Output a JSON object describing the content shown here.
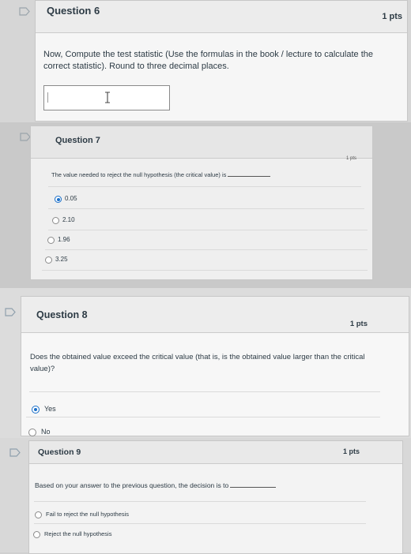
{
  "q6": {
    "title": "Question 6",
    "points": "1 pts",
    "text": "Now, Compute the test statistic (Use the formulas in the book / lecture to calculate the correct statistic). Round to three decimal places.",
    "answer_value": ""
  },
  "q7": {
    "title": "Question 7",
    "points": "1 pts",
    "text": "The value needed to reject the null hypothesis (the critical value) is",
    "options": [
      "0.05",
      "2.10",
      "1.96",
      "3.25"
    ],
    "selected_index": 0
  },
  "q8": {
    "title": "Question 8",
    "points": "1 pts",
    "text": "Does the obtained value exceed the critical value (that is, is the obtained value larger than the critical value)?",
    "options": [
      "Yes",
      "No"
    ],
    "selected_index": 0
  },
  "q9": {
    "title": "Question 9",
    "points": "1 pts",
    "text": "Based on your answer to the previous question, the decision is to",
    "options": [
      "Fail to reject the null hypothesis",
      "Reject the null hypothesis"
    ],
    "selected_index": -1
  },
  "icons": {
    "flag": "flag-icon"
  }
}
